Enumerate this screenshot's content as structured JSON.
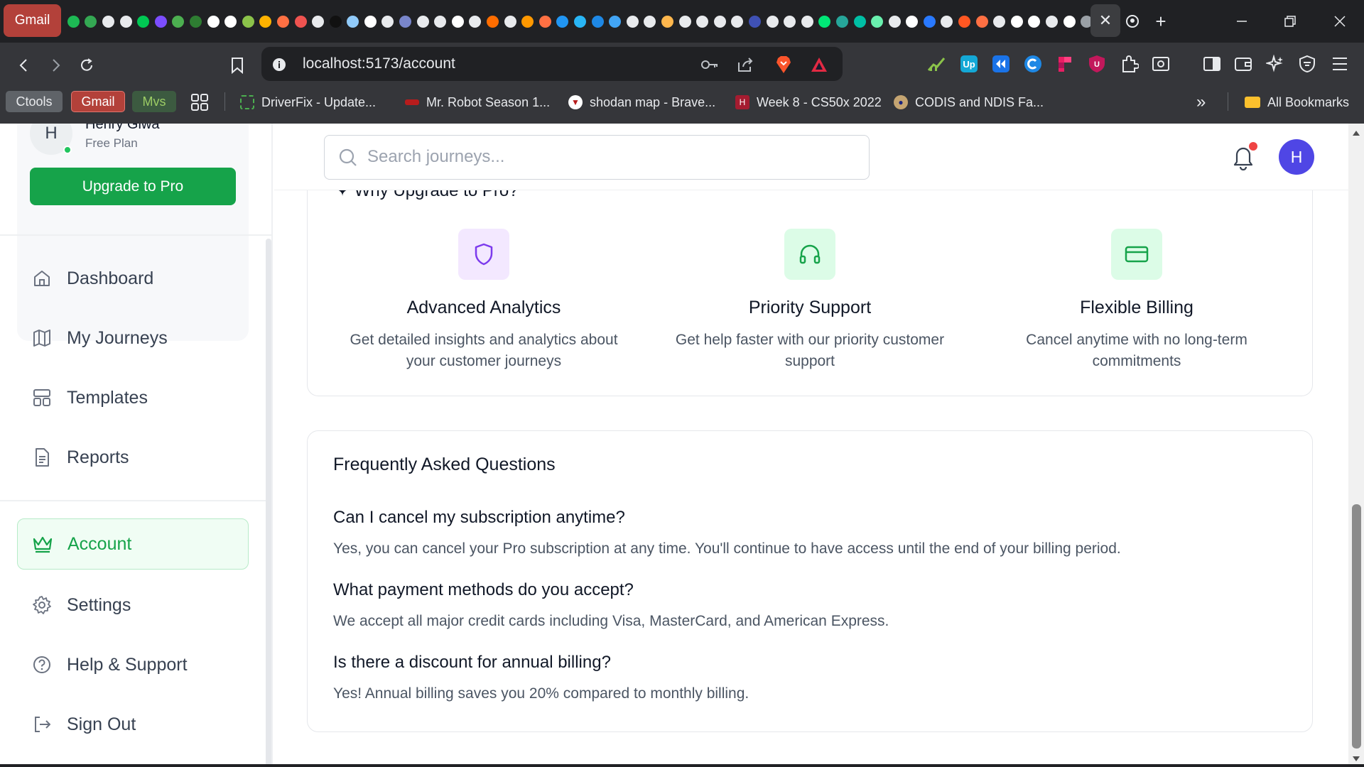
{
  "browser": {
    "tab_gmail": "Gmail",
    "close_tab": "✕",
    "new_tab": "+",
    "url_host": "localhost",
    "url_path": ":5173/account",
    "bookmarks": [
      {
        "label": "Ctools"
      },
      {
        "label": "Gmail"
      },
      {
        "label": "Mvs"
      },
      {
        "label": "DriverFix - Update..."
      },
      {
        "label": "Mr. Robot Season 1..."
      },
      {
        "label": "shodan map - Brave..."
      },
      {
        "label": "Week 8 - CS50x 2022"
      },
      {
        "label": "CODIS and NDIS Fa..."
      },
      {
        "label": "All Bookmarks"
      }
    ],
    "overflow": "»"
  },
  "sidebar": {
    "user_initial": "H",
    "user_name": "Henry Giwa",
    "user_plan": "Free Plan",
    "upgrade_label": "Upgrade to Pro",
    "nav": [
      {
        "label": "Dashboard",
        "icon": "home-icon"
      },
      {
        "label": "My Journeys",
        "icon": "map-icon"
      },
      {
        "label": "Templates",
        "icon": "layout-icon"
      },
      {
        "label": "Reports",
        "icon": "file-icon"
      }
    ],
    "nav_bottom": [
      {
        "label": "Account",
        "icon": "crown-icon",
        "active": true
      },
      {
        "label": "Settings",
        "icon": "gear-icon"
      },
      {
        "label": "Help & Support",
        "icon": "help-circle-icon"
      },
      {
        "label": "Sign Out",
        "icon": "sign-out-icon"
      }
    ]
  },
  "header": {
    "search_placeholder": "Search journeys...",
    "avatar_initial": "H"
  },
  "upgrade_section": {
    "title": "Why Upgrade to Pro?",
    "features": [
      {
        "title": "Advanced Analytics",
        "desc_line1": "Get detailed insights and analytics about",
        "desc_line2": "your customer journeys",
        "icon": "shield-icon",
        "icon_bg": "#f3e8ff",
        "icon_color": "#7c3aed"
      },
      {
        "title": "Priority Support",
        "desc_line1": "Get help faster with our priority customer",
        "desc_line2": "support",
        "icon": "headphones-icon",
        "icon_bg": "#dcfce7",
        "icon_color": "#16a34a"
      },
      {
        "title": "Flexible Billing",
        "desc_line1": "Cancel anytime with no long-term",
        "desc_line2": "commitments",
        "icon": "credit-card-icon",
        "icon_bg": "#dcfce7",
        "icon_color": "#16a34a"
      }
    ]
  },
  "faq": {
    "title": "Frequently Asked Questions",
    "items": [
      {
        "q": "Can I cancel my subscription anytime?",
        "a": "Yes, you can cancel your Pro subscription at any time. You'll continue to have access until the end of your billing period."
      },
      {
        "q": "What payment methods do you accept?",
        "a": "We accept all major credit cards including Visa, MasterCard, and American Express."
      },
      {
        "q": "Is there a discount for annual billing?",
        "a": "Yes! Annual billing saves you 20% compared to monthly billing."
      }
    ]
  },
  "colors": {
    "accent": "#16a34a",
    "active_bg": "#f0fdf4",
    "avatar": "#4f46e5",
    "notification_dot": "#ef4444"
  }
}
